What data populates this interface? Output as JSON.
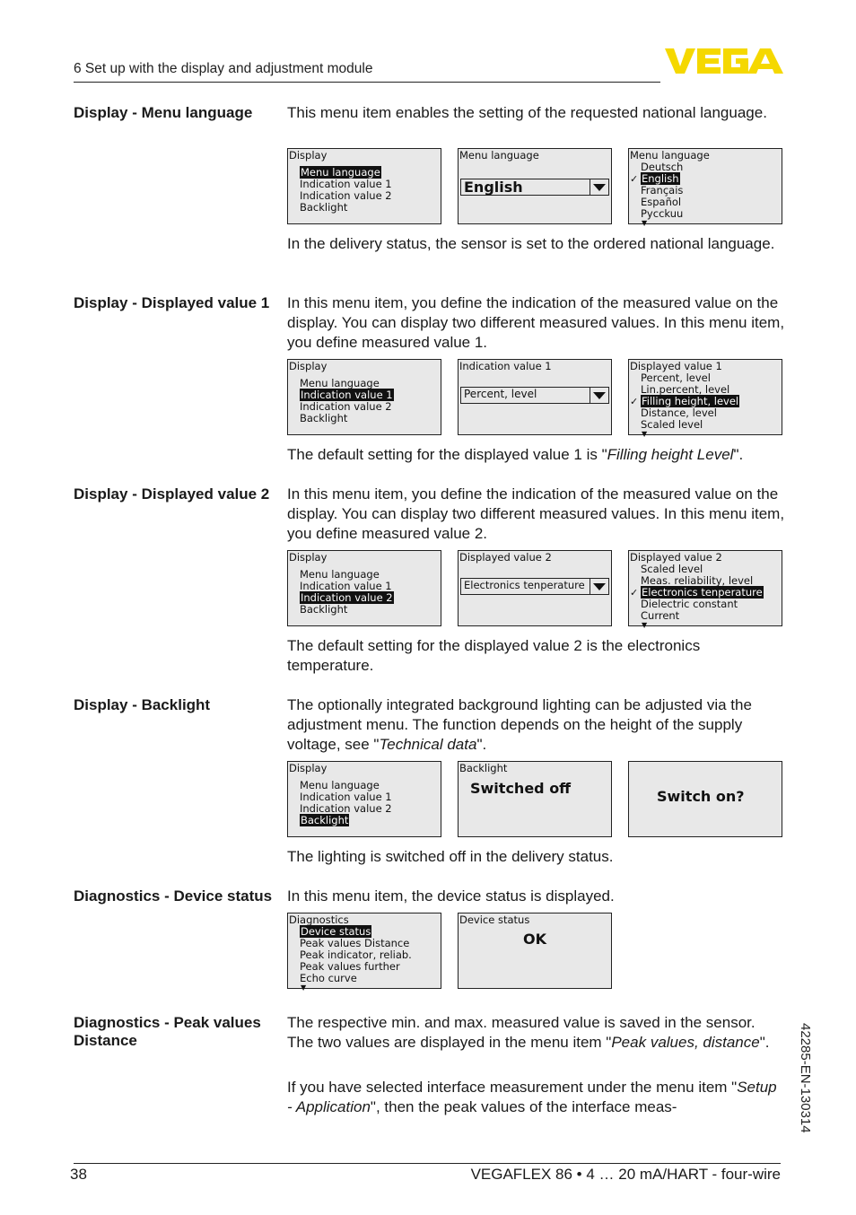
{
  "header": {
    "chapter": "6 Set up with the display and adjustment module",
    "logo_text": "VEGA",
    "logo_color": "#f5d800"
  },
  "side_code": "42285-EN-130314",
  "footer": {
    "page_number": "38",
    "doc_title": "VEGAFLEX 86 • 4 … 20 mA/HART - four-wire"
  },
  "sections": {
    "menu_language": {
      "label": "Display - Menu language",
      "intro": "This menu item enables the setting of the requested national language.",
      "note": "In the delivery status, the sensor is set to the ordered national language.",
      "screens": {
        "menu": {
          "title": "Display",
          "items": [
            "Menu language",
            "Indication value 1",
            "Indication value 2",
            "Backlight"
          ],
          "selected": 0
        },
        "select": {
          "title": "Menu language",
          "value": "English"
        },
        "list": {
          "title": "Menu language",
          "items": [
            "Deutsch",
            "English",
            "Français",
            "Español",
            "Pycckuu"
          ],
          "checked": 1
        }
      }
    },
    "displayed_value_1": {
      "label": "Display - Displayed value 1",
      "intro": "In this menu item, you define the indication of the measured value on the display. You can display two different measured values. In this menu item, you define measured value 1.",
      "note_pre": "The default setting for the displayed value 1 is \"",
      "note_em": "Filling height Level",
      "note_post": "\".",
      "screens": {
        "menu": {
          "title": "Display",
          "items": [
            "Menu language",
            "Indication value 1",
            "Indication value 2",
            "Backlight"
          ],
          "selected": 1
        },
        "select": {
          "title": "Indication value 1",
          "value": "Percent, level"
        },
        "list": {
          "title": "Displayed value 1",
          "items": [
            "Percent, level",
            "Lin.percent, level",
            "Filling height, level",
            "Distance, level",
            "Scaled level"
          ],
          "checked": 2
        }
      }
    },
    "displayed_value_2": {
      "label": "Display - Displayed value 2",
      "intro": "In this menu item, you define the indication of the measured value on the display. You can display two different measured values. In this menu item, you define measured value 2.",
      "note": "The default setting for the displayed value 2 is the electronics temperature.",
      "screens": {
        "menu": {
          "title": "Display",
          "items": [
            "Menu language",
            "Indication value 1",
            "Indication value 2",
            "Backlight"
          ],
          "selected": 2
        },
        "select": {
          "title": "Displayed value 2",
          "value": "Electronics tenperature"
        },
        "list": {
          "title": "Displayed value 2",
          "items": [
            "Scaled level",
            "Meas. reliability, level",
            "Electronics tenperature",
            "Dielectric constant",
            "Current"
          ],
          "checked": 2
        }
      }
    },
    "backlight": {
      "label": "Display - Backlight",
      "intro_pre": "The optionally integrated background lighting can be adjusted via the adjustment menu. The function depends on the height of the supply voltage, see \"",
      "intro_em": "Technical data",
      "intro_post": "\".",
      "note": "The lighting is switched off in the delivery status.",
      "screens": {
        "menu": {
          "title": "Display",
          "items": [
            "Menu language",
            "Indication value 1",
            "Indication value 2",
            "Backlight"
          ],
          "selected": 3
        },
        "state": {
          "title": "Backlight",
          "value": "Switched off"
        },
        "confirm": {
          "value": "Switch on?"
        }
      }
    },
    "device_status": {
      "label": "Diagnostics - Device status",
      "intro": "In this menu item, the device status is displayed.",
      "screens": {
        "menu": {
          "title": "Diagnostics",
          "items": [
            "Device status",
            "Peak values Distance",
            "Peak indicator, reliab.",
            "Peak values further",
            "Echo curve"
          ],
          "selected": 0
        },
        "status": {
          "title": "Device status",
          "value": "OK"
        }
      }
    },
    "peak_values": {
      "label": "Diagnostics - Peak values Distance",
      "p1_pre": "The respective min. and max. measured value is saved in the sensor. The two values are displayed in the menu item \"",
      "p1_em": "Peak values, distance",
      "p1_post": "\".",
      "p2_pre": "If you have selected interface measurement under the menu item \"",
      "p2_em": "Setup - Application",
      "p2_post": "\", then the peak values of the interface meas-"
    }
  }
}
